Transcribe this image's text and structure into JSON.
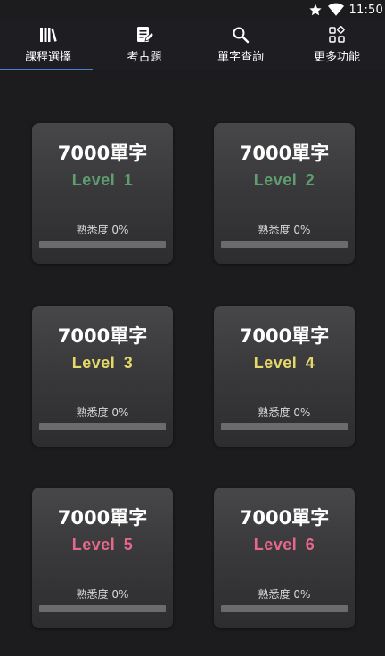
{
  "status_bar": {
    "time": "11:50",
    "icons": [
      "star-icon",
      "wifi-icon"
    ]
  },
  "tabs": [
    {
      "label": "課程選擇",
      "icon": "books-icon",
      "active": true
    },
    {
      "label": "考古題",
      "icon": "edit-note-icon",
      "active": false
    },
    {
      "label": "單字查詢",
      "icon": "search-icon",
      "active": false
    },
    {
      "label": "更多功能",
      "icon": "apps-icon",
      "active": false
    }
  ],
  "levels": [
    {
      "title": "7000單字",
      "level": "Level  1",
      "familiarity_label": "熟悉度",
      "familiarity_value": "0%",
      "progress": 0,
      "color": "#5f9e6e"
    },
    {
      "title": "7000單字",
      "level": "Level  2",
      "familiarity_label": "熟悉度",
      "familiarity_value": "0%",
      "progress": 0,
      "color": "#5f9e6e"
    },
    {
      "title": "7000單字",
      "level": "Level  3",
      "familiarity_label": "熟悉度",
      "familiarity_value": "0%",
      "progress": 0,
      "color": "#e6d86a"
    },
    {
      "title": "7000單字",
      "level": "Level  4",
      "familiarity_label": "熟悉度",
      "familiarity_value": "0%",
      "progress": 0,
      "color": "#e6d86a"
    },
    {
      "title": "7000單字",
      "level": "Level  5",
      "familiarity_label": "熟悉度",
      "familiarity_value": "0%",
      "progress": 0,
      "color": "#e8688a"
    },
    {
      "title": "7000單字",
      "level": "Level  6",
      "familiarity_label": "熟悉度",
      "familiarity_value": "0%",
      "progress": 0,
      "color": "#e8688a"
    }
  ],
  "colors": {
    "background": "#1c1c1f",
    "tab_indicator": "#4a7fcf",
    "progress_track": "#6b6b6d"
  }
}
